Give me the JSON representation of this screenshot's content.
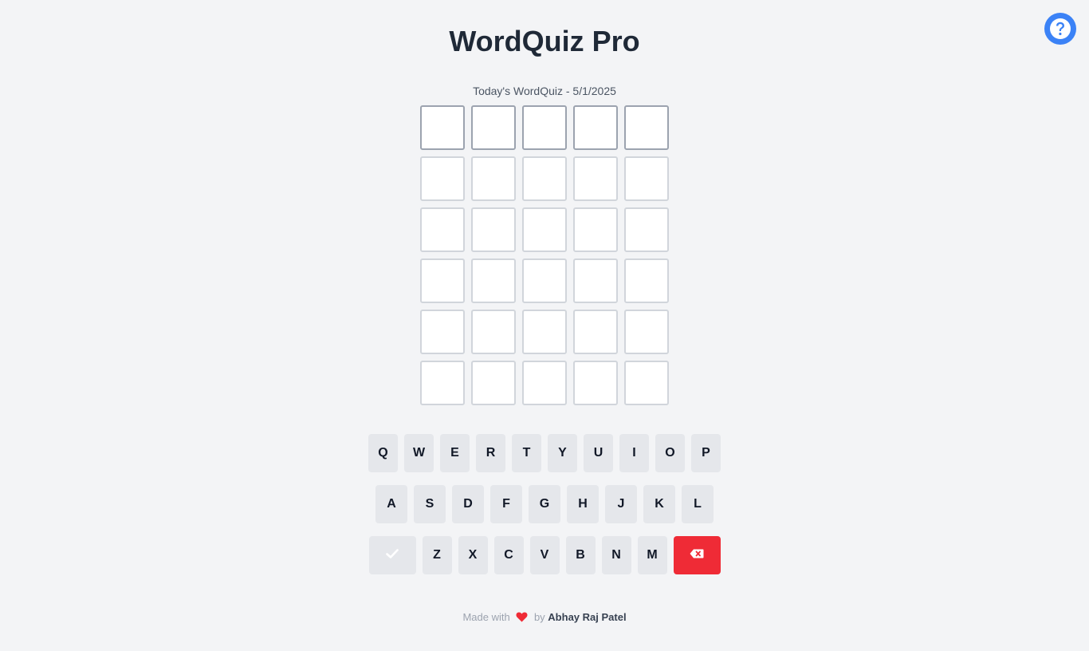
{
  "header": {
    "title": "WordQuiz Pro",
    "help_icon": "question-circle-icon"
  },
  "game": {
    "subtitle": "Today's WordQuiz - 5/1/2025",
    "rows": 6,
    "cols": 5,
    "active_row": 0,
    "guesses": [
      [
        "",
        "",
        "",
        "",
        ""
      ],
      [
        "",
        "",
        "",
        "",
        ""
      ],
      [
        "",
        "",
        "",
        "",
        ""
      ],
      [
        "",
        "",
        "",
        "",
        ""
      ],
      [
        "",
        "",
        "",
        "",
        ""
      ],
      [
        "",
        "",
        "",
        "",
        ""
      ]
    ]
  },
  "keyboard": {
    "row1": [
      "Q",
      "W",
      "E",
      "R",
      "T",
      "Y",
      "U",
      "I",
      "O",
      "P"
    ],
    "row2": [
      "A",
      "S",
      "D",
      "F",
      "G",
      "H",
      "J",
      "K",
      "L"
    ],
    "row3": [
      "Z",
      "X",
      "C",
      "V",
      "B",
      "N",
      "M"
    ],
    "enter_icon": "check-icon",
    "backspace_icon": "backspace-icon"
  },
  "footer": {
    "made_with": "Made with",
    "heart_icon": "heart-icon",
    "by": "by",
    "author": "Abhay Raj Patel"
  },
  "colors": {
    "background": "#f3f4f6",
    "accent": "#3b82f6",
    "backspace": "#ef2b36",
    "heart": "#ef2b36",
    "key": "#e5e7eb"
  }
}
